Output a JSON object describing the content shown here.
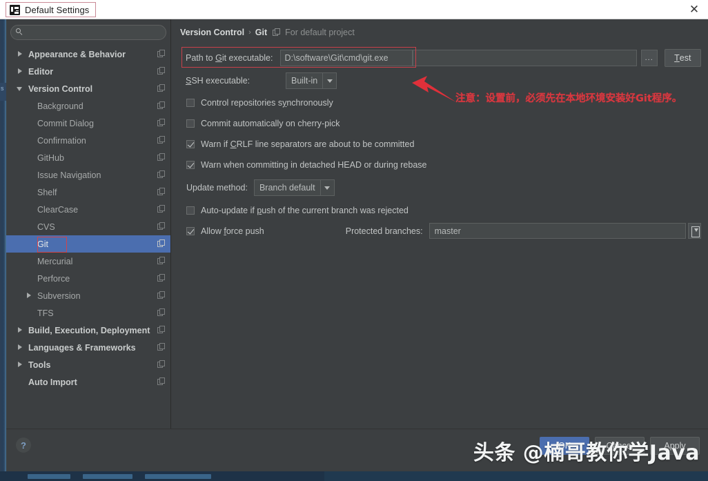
{
  "window": {
    "title": "Default Settings",
    "app_icon": "intellij-idea-icon",
    "close_label": "✕"
  },
  "sidebar": {
    "search": {
      "value": "",
      "placeholder": "",
      "icon": "search-icon"
    },
    "items": [
      {
        "label": "Appearance & Behavior",
        "indent": 0,
        "arrow": "right",
        "bold": true,
        "selected": false,
        "copy_icon": true
      },
      {
        "label": "Editor",
        "indent": 0,
        "arrow": "right",
        "bold": true,
        "selected": false,
        "copy_icon": true
      },
      {
        "label": "Version Control",
        "indent": 0,
        "arrow": "down",
        "bold": true,
        "selected": false,
        "copy_icon": true
      },
      {
        "label": "Background",
        "indent": 1,
        "arrow": "none",
        "bold": false,
        "selected": false,
        "copy_icon": true
      },
      {
        "label": "Commit Dialog",
        "indent": 1,
        "arrow": "none",
        "bold": false,
        "selected": false,
        "copy_icon": true
      },
      {
        "label": "Confirmation",
        "indent": 1,
        "arrow": "none",
        "bold": false,
        "selected": false,
        "copy_icon": true
      },
      {
        "label": "GitHub",
        "indent": 1,
        "arrow": "none",
        "bold": false,
        "selected": false,
        "copy_icon": true
      },
      {
        "label": "Issue Navigation",
        "indent": 1,
        "arrow": "none",
        "bold": false,
        "selected": false,
        "copy_icon": true
      },
      {
        "label": "Shelf",
        "indent": 1,
        "arrow": "none",
        "bold": false,
        "selected": false,
        "copy_icon": true
      },
      {
        "label": "ClearCase",
        "indent": 1,
        "arrow": "none",
        "bold": false,
        "selected": false,
        "copy_icon": true
      },
      {
        "label": "CVS",
        "indent": 1,
        "arrow": "none",
        "bold": false,
        "selected": false,
        "copy_icon": true
      },
      {
        "label": "Git",
        "indent": 1,
        "arrow": "none",
        "bold": false,
        "selected": true,
        "copy_icon": true
      },
      {
        "label": "Mercurial",
        "indent": 1,
        "arrow": "none",
        "bold": false,
        "selected": false,
        "copy_icon": true
      },
      {
        "label": "Perforce",
        "indent": 1,
        "arrow": "none",
        "bold": false,
        "selected": false,
        "copy_icon": true
      },
      {
        "label": "Subversion",
        "indent": 1,
        "arrow": "right",
        "bold": false,
        "selected": false,
        "copy_icon": true
      },
      {
        "label": "TFS",
        "indent": 1,
        "arrow": "none",
        "bold": false,
        "selected": false,
        "copy_icon": true
      },
      {
        "label": "Build, Execution, Deployment",
        "indent": 0,
        "arrow": "right",
        "bold": true,
        "selected": false,
        "copy_icon": true
      },
      {
        "label": "Languages & Frameworks",
        "indent": 0,
        "arrow": "right",
        "bold": true,
        "selected": false,
        "copy_icon": true
      },
      {
        "label": "Tools",
        "indent": 0,
        "arrow": "right",
        "bold": true,
        "selected": false,
        "copy_icon": true
      },
      {
        "label": "Auto Import",
        "indent": 0,
        "arrow": "none",
        "bold": true,
        "selected": false,
        "copy_icon": true
      }
    ]
  },
  "breadcrumb": {
    "root": "Version Control",
    "separator": "›",
    "leaf": "Git",
    "scope_note": "For default project",
    "scope_icon": "copy-scope-icon"
  },
  "settings": {
    "path_label_pre": "Path to ",
    "path_label_mnemonic": "G",
    "path_label_post": "it executable:",
    "path_label_full": "Path to Git executable:",
    "path_value": "D:\\software\\Git\\cmd\\git.exe",
    "path_value_2": "",
    "browse_label": "...",
    "test_label": "Test",
    "test_mnemonic": "T",
    "ssh_label_pre": "",
    "ssh_label_mnemonic": "S",
    "ssh_label_post": "SH executable:",
    "ssh_label_full": "SSH executable:",
    "ssh_value": "Built-in",
    "update_method_label": "Update method:",
    "update_method_value": "Branch default",
    "protected_label": "Protected branches:",
    "protected_value": "master",
    "checkboxes": [
      {
        "label": "Control repositories s",
        "mnemonic": "y",
        "label_post": "nchronously",
        "checked": false,
        "full": "Control repositories synchronously"
      },
      {
        "label": "Commit automatically on cherry-pick",
        "mnemonic": "",
        "label_post": "",
        "checked": false,
        "full": "Commit automatically on cherry-pick"
      },
      {
        "label": "Warn if ",
        "mnemonic": "C",
        "label_post": "RLF line separators are about to be committed",
        "checked": true,
        "full": "Warn if CRLF line separators are about to be committed"
      },
      {
        "label": "Warn when committing in detached HEAD or during rebase",
        "mnemonic": "",
        "label_post": "",
        "checked": true,
        "full": "Warn when committing in detached HEAD or during rebase"
      }
    ],
    "checkbox_auto_update": {
      "label": "Auto-update if ",
      "mnemonic": "p",
      "label_post": "ush of the current branch was rejected",
      "checked": false,
      "full": "Auto-update if push of the current branch was rejected"
    },
    "checkbox_force_push": {
      "label": "Allow ",
      "mnemonic": "f",
      "label_post": "orce push",
      "checked": true,
      "full": "Allow force push"
    },
    "expand_icon": "expand-branches-icon"
  },
  "annotation": {
    "text": "注意：设置前，必须先在本地环境安装好Git程序。",
    "arrow": "red-annotation-arrow",
    "color": "#d9373f"
  },
  "footer": {
    "help_label": "?",
    "buttons": [
      "OK",
      "Cancel",
      "Apply"
    ]
  },
  "watermark": {
    "text": "头条 @楠哥教你学Java"
  },
  "colors": {
    "accent_selection": "#4b6eaf",
    "annotation_red": "#d9373f",
    "panel_bg": "#3c3f41",
    "field_bg": "#45494a"
  }
}
